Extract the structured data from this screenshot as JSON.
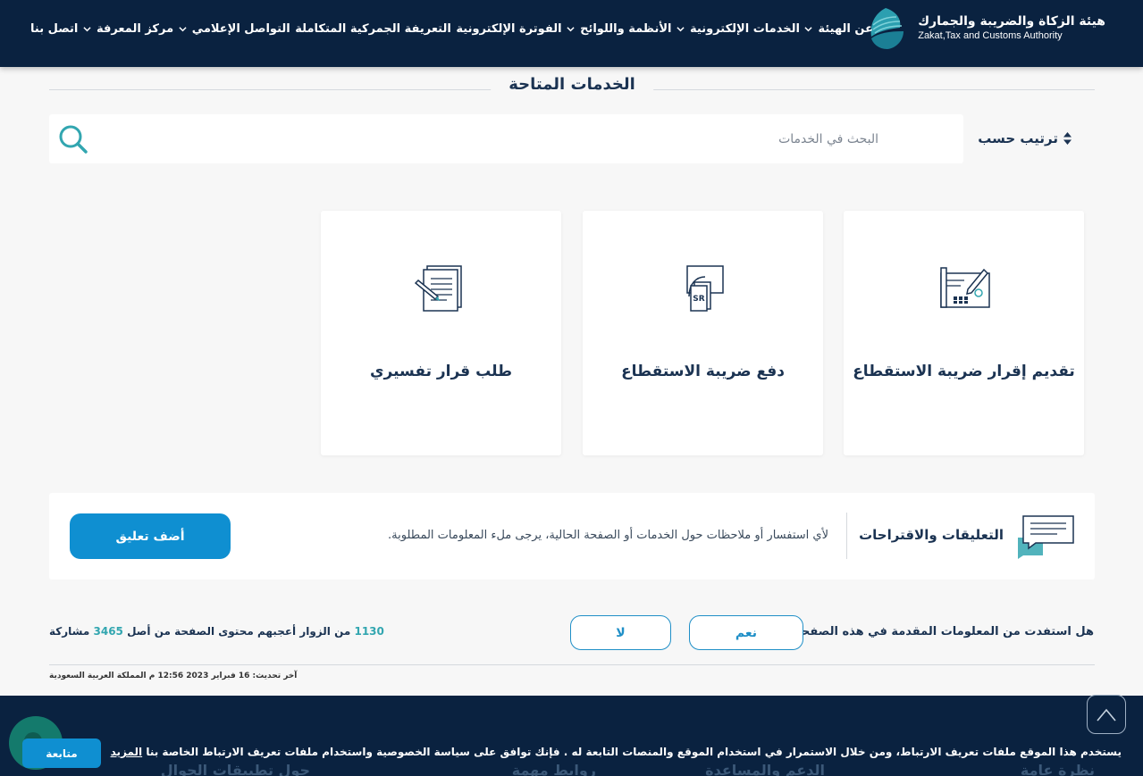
{
  "header": {
    "logo_ar": "هيئة الزكاة والضريبة والجمارك",
    "logo_en": "Zakat,Tax and Customs Authority",
    "nav": [
      {
        "label": "عن الهيئة",
        "has_dropdown": true
      },
      {
        "label": "الخدمات الإلكترونية",
        "has_dropdown": true
      },
      {
        "label": "الأنظمة واللوائح",
        "has_dropdown": true
      },
      {
        "label": "الفوترة الإلكترونية",
        "has_dropdown": false
      },
      {
        "label": "التعريفة الجمركية المتكاملة",
        "has_dropdown": false
      },
      {
        "label": "التواصل الإعلامي",
        "has_dropdown": true
      },
      {
        "label": "مركز المعرفة",
        "has_dropdown": true
      },
      {
        "label": "اتصل بنا",
        "has_dropdown": false
      }
    ]
  },
  "main": {
    "section_title": "الخدمات المتاحة",
    "sort_label": "ترتيب حسب",
    "search_placeholder": "البحث في الخدمات",
    "cards": [
      {
        "label": "تقديم إقرار ضريبة الاستقطاع",
        "icon": "tax-form-icon"
      },
      {
        "label": "دفع ضريبة الاستقطاع",
        "icon": "payment-card-icon"
      },
      {
        "label": "طلب قرار تفسيري",
        "icon": "document-request-icon"
      }
    ]
  },
  "feedback": {
    "title": "التعليقات والاقتراحات",
    "text": "لأي استفسار أو ملاحظات حول الخدمات أو الصفحة الحالية، يرجى ملء المعلومات المطلوبة.",
    "button": "أضف تعليق"
  },
  "rating": {
    "question": "هل استفدت من المعلومات المقدمة في هذه الصفحة؟",
    "yes": "نعم",
    "no": "لا",
    "liked_count": "1130",
    "stats_middle": "من الزوار أعجبهم محتوى الصفحة من أصل",
    "total_count": "3465",
    "stats_suffix": "مشاركة",
    "last_update": "آخر تحديث: 16 فبراير 2023 12:56 م المملكة العربية السعودية"
  },
  "footer": {
    "columns": [
      "نظرة عامة",
      "الدعم والمساعدة",
      "روابط مهمة",
      "حول تطبيقات الجوال"
    ]
  },
  "cookie": {
    "text": "يستخدم هذا الموقع ملفات تعريف الارتباط، ومن خلال الاستمرار في استخدام الموقع والمنصات التابعة له . فإنك توافق على سياسة الخصوصية واستخدام ملفات تعريف الارتباط الخاصة بنا",
    "more": "المزيد",
    "button": "متابعة"
  },
  "colors": {
    "navy": "#0a2240",
    "accent_blue": "#0f8fd1",
    "teal": "#32a6b0"
  }
}
